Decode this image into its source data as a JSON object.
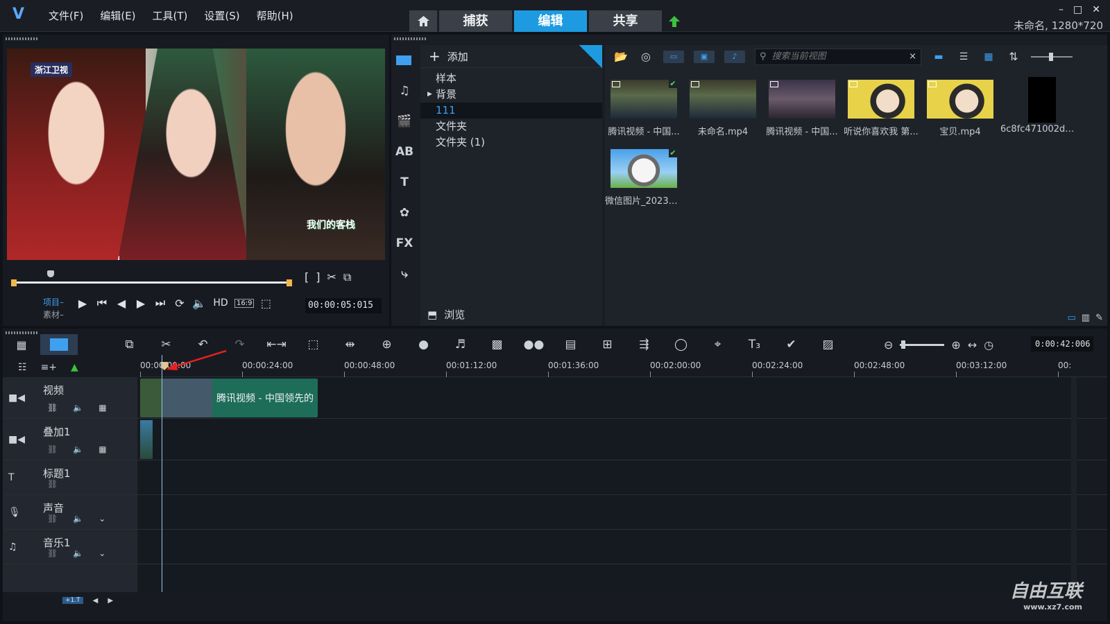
{
  "app": {
    "menu": [
      "文件(F)",
      "编辑(E)",
      "工具(T)",
      "设置(S)",
      "帮助(H)"
    ],
    "mode_tabs": [
      "捕获",
      "编辑",
      "共享"
    ],
    "active_mode": "编辑",
    "project_info": "未命名, 1280*720"
  },
  "preview": {
    "station_logo": "浙江卫视",
    "show_logo": "我们的客栈",
    "mode_project": "项目",
    "mode_clip": "素材",
    "timecode": "00:00:05:015",
    "hd_label": "HD",
    "ratio_label": "16:9"
  },
  "library": {
    "add_label": "添加",
    "folders": [
      "样本",
      "背景",
      "111",
      "文件夹",
      "文件夹 (1)"
    ],
    "selected_folder": "111",
    "browse_label": "浏览",
    "search_placeholder": "搜索当前视图",
    "items": [
      {
        "label": "腾讯视频 - 中国...",
        "checked": true
      },
      {
        "label": "未命名.mp4",
        "checked": false
      },
      {
        "label": "腾讯视频 - 中国...",
        "checked": false
      },
      {
        "label": "听说你喜欢我 第...",
        "checked": false
      },
      {
        "label": "宝贝.mp4",
        "checked": false
      },
      {
        "label": "6c8fc471002dd...",
        "checked": false
      },
      {
        "label": "微信图片_20230...",
        "checked": true
      }
    ]
  },
  "timeline": {
    "duration": "0:00:42:006",
    "ruler": [
      "00:00:00:00",
      "00:00:24:00",
      "00:00:48:00",
      "00:01:12:00",
      "00:01:36:00",
      "00:02:00:00",
      "00:02:24:00",
      "00:02:48:00",
      "00:03:12:00",
      "00:"
    ],
    "tracks": [
      "视频",
      "叠加1",
      "标题1",
      "声音",
      "音乐1"
    ],
    "clip_name": "腾讯视频 - 中国领先的",
    "footer_badge": "+1.T"
  },
  "watermark": {
    "text": "自由互联",
    "url": "www.xz7.com"
  },
  "colors": {
    "accent": "#1e9be0",
    "clip": "#1d6d58",
    "selection": "#3fa0f0"
  }
}
